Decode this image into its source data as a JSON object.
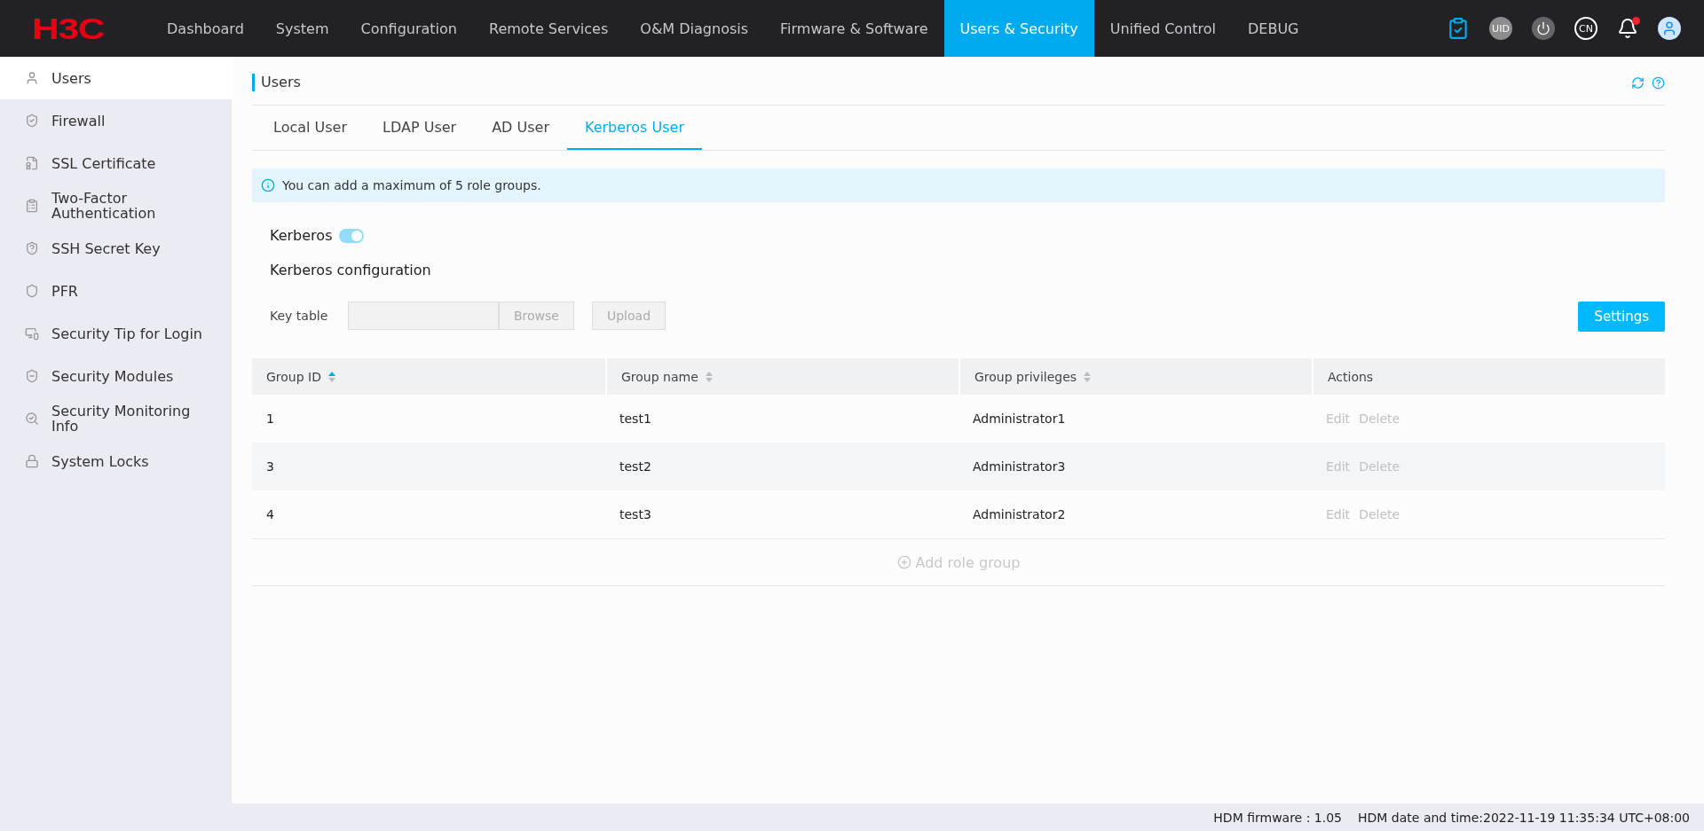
{
  "top_bar": {
    "logo": "H3C",
    "nav": [
      {
        "label": "Dashboard",
        "selected": false
      },
      {
        "label": "System",
        "selected": false
      },
      {
        "label": "Configuration",
        "selected": false
      },
      {
        "label": "Remote Services",
        "selected": false
      },
      {
        "label": "O&M Diagnosis",
        "selected": false
      },
      {
        "label": "Firmware & Software",
        "selected": false
      },
      {
        "label": "Users & Security",
        "selected": true
      },
      {
        "label": "Unified Control",
        "selected": false
      },
      {
        "label": "DEBUG",
        "selected": false
      }
    ],
    "uid_badge": "UID",
    "language": "CN",
    "has_notification": true
  },
  "sidebar": {
    "items": [
      {
        "label": "Users",
        "selected": true
      },
      {
        "label": "Firewall",
        "selected": false
      },
      {
        "label": "SSL Certificate",
        "selected": false
      },
      {
        "label": "Two-Factor Authentication",
        "selected": false
      },
      {
        "label": "SSH Secret Key",
        "selected": false
      },
      {
        "label": "PFR",
        "selected": false
      },
      {
        "label": "Security Tip for Login",
        "selected": false
      },
      {
        "label": "Security Modules",
        "selected": false
      },
      {
        "label": "Security Monitoring Info",
        "selected": false
      },
      {
        "label": "System Locks",
        "selected": false
      }
    ]
  },
  "page": {
    "title": "Users",
    "tabs": [
      {
        "label": "Local User",
        "selected": false
      },
      {
        "label": "LDAP User",
        "selected": false
      },
      {
        "label": "AD User",
        "selected": false
      },
      {
        "label": "Kerberos User",
        "selected": true
      }
    ],
    "notice": "You can add a maximum of 5 role groups.",
    "kerberos": {
      "label": "Kerberos",
      "on": true
    },
    "section_title": "Kerberos configuration",
    "key_table": {
      "label": "Key table",
      "browse": "Browse",
      "upload": "Upload",
      "disabled": true
    },
    "settings_button": "Settings",
    "table": {
      "columns": [
        {
          "label": "Group ID",
          "sortable": true,
          "sorted": true
        },
        {
          "label": "Group name",
          "sortable": true,
          "sorted": false
        },
        {
          "label": "Group privileges",
          "sortable": true,
          "sorted": false
        },
        {
          "label": "Actions",
          "sortable": false
        }
      ],
      "rows": [
        {
          "cells": [
            "1",
            "test1",
            "Administrator1"
          ],
          "actions": [
            {
              "label": "Edit",
              "disabled": true
            },
            {
              "label": "Delete",
              "disabled": true
            }
          ]
        },
        {
          "cells": [
            "3",
            "test2",
            "Administrator3"
          ],
          "actions": [
            {
              "label": "Edit",
              "disabled": true
            },
            {
              "label": "Delete",
              "disabled": true
            }
          ]
        },
        {
          "cells": [
            "4",
            "test3",
            "Administrator2"
          ],
          "actions": [
            {
              "label": "Edit",
              "disabled": true
            },
            {
              "label": "Delete",
              "disabled": true
            }
          ]
        }
      ],
      "add_button": "Add role group",
      "add_disabled": true
    }
  },
  "status_bar": {
    "firmware": "HDM firmware : 1.05",
    "datetime": "HDM date and time:2022-11-19 11:35:34 UTC+08:00"
  }
}
